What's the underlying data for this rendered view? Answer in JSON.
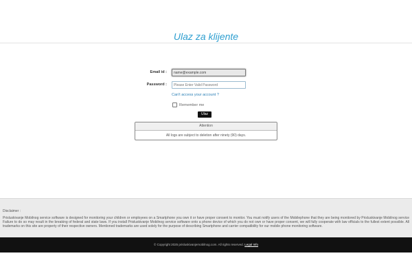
{
  "header": {
    "title": "Ulaz za klijente"
  },
  "login": {
    "email_label": "Email id :",
    "email_value": "name@example.com",
    "password_label": "Password :",
    "password_placeholder": "Please Enter Valid Password",
    "forgot_link": "Can't access your account ?",
    "remember_label": "Remember me",
    "remember_checked": false,
    "submit_label": "Ulaz"
  },
  "notice": {
    "title": "Attention",
    "text": "All logs are subject to deletion after ninety (90) days."
  },
  "disclaimer": {
    "title": "Disclaimer :",
    "text": "Prisluskivanje Mobilnog service software is designed for monitoring your children or employees on a Smartphone you own it or have proper consent to monitor. You must notify users of the Mobilephone that they are being monitored by Prisluskivanje Mobilnog service Failure to do so may result in the breaking of federal and state laws. If you install Prisluskivanje Mobilnog service software onto a phone device of which you do not own or have proper consent, we will fully cooperate with law officials to the fullest extent possible. All trademarks on this site are property of their respective owners. Mentioned trademarks are used solely for the purpose of describing Smartphone and carrier compatibility for our mobile phone monitoring software."
  },
  "footer": {
    "copyright": "© Copyright 2025 prisluskivanjemobilnog.com. All rights reserved.",
    "legal_link": "Legal Info"
  }
}
